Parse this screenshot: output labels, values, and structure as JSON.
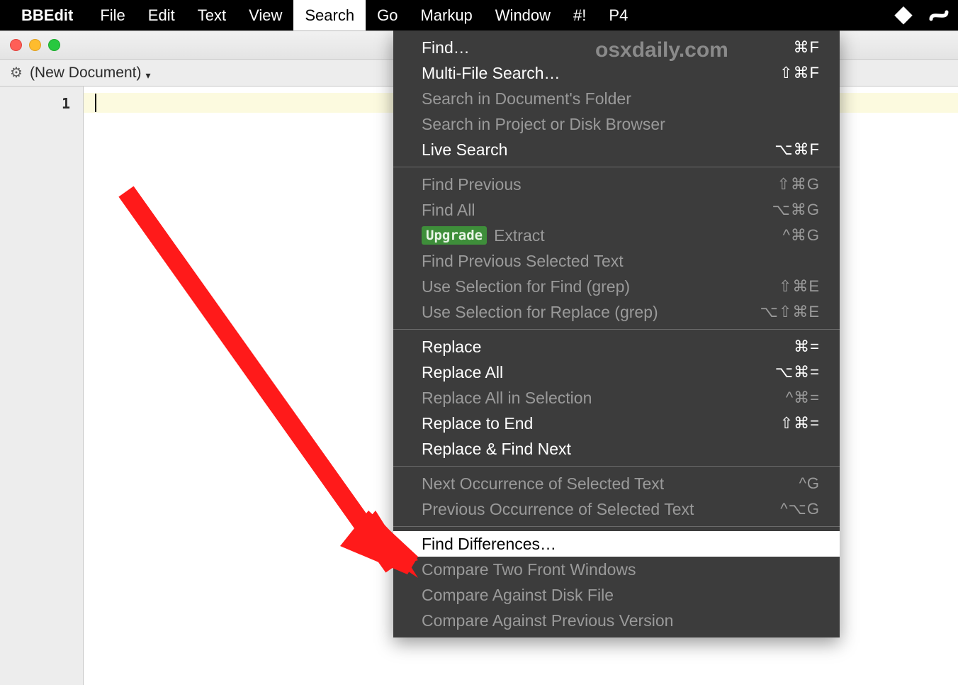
{
  "menubar": {
    "app_name": "BBEdit",
    "items": [
      "File",
      "Edit",
      "Text",
      "View",
      "Search",
      "Go",
      "Markup",
      "Window",
      "#!",
      "P4"
    ],
    "active_index": 4
  },
  "window": {
    "doc_label": "(New Document)",
    "line_number": "1"
  },
  "dropdown": {
    "groups": [
      [
        {
          "label": "Find…",
          "shortcut": "⌘F",
          "enabled": true
        },
        {
          "label": "Multi-File Search…",
          "shortcut": "⇧⌘F",
          "enabled": true
        },
        {
          "label": "Search in Document's Folder",
          "shortcut": "",
          "enabled": false
        },
        {
          "label": "Search in Project or Disk Browser",
          "shortcut": "",
          "enabled": false
        },
        {
          "label": "Live Search",
          "shortcut": "⌥⌘F",
          "enabled": true
        }
      ],
      [
        {
          "label": "Find Previous",
          "shortcut": "⇧⌘G",
          "enabled": false
        },
        {
          "label": "Find All",
          "shortcut": "⌥⌘G",
          "enabled": false
        },
        {
          "label": "Extract",
          "shortcut": "^⌘G",
          "enabled": false,
          "badge": "Upgrade"
        },
        {
          "label": "Find Previous Selected Text",
          "shortcut": "",
          "enabled": false
        },
        {
          "label": "Use Selection for Find (grep)",
          "shortcut": "⇧⌘E",
          "enabled": false
        },
        {
          "label": "Use Selection for Replace (grep)",
          "shortcut": "⌥⇧⌘E",
          "enabled": false
        }
      ],
      [
        {
          "label": "Replace",
          "shortcut": "⌘=",
          "enabled": true
        },
        {
          "label": "Replace All",
          "shortcut": "⌥⌘=",
          "enabled": true
        },
        {
          "label": "Replace All in Selection",
          "shortcut": "^⌘=",
          "enabled": false
        },
        {
          "label": "Replace to End",
          "shortcut": "⇧⌘=",
          "enabled": true
        },
        {
          "label": "Replace & Find Next",
          "shortcut": "",
          "enabled": true
        }
      ],
      [
        {
          "label": "Next Occurrence of Selected Text",
          "shortcut": "^G",
          "enabled": false
        },
        {
          "label": "Previous Occurrence of Selected Text",
          "shortcut": "^⌥G",
          "enabled": false
        }
      ],
      [
        {
          "label": "Find Differences…",
          "shortcut": "",
          "enabled": true,
          "highlight": true
        },
        {
          "label": "Compare Two Front Windows",
          "shortcut": "",
          "enabled": false
        },
        {
          "label": "Compare Against Disk File",
          "shortcut": "",
          "enabled": false
        },
        {
          "label": "Compare Against Previous Version",
          "shortcut": "",
          "enabled": false
        }
      ]
    ]
  },
  "watermark": "osxdaily.com"
}
